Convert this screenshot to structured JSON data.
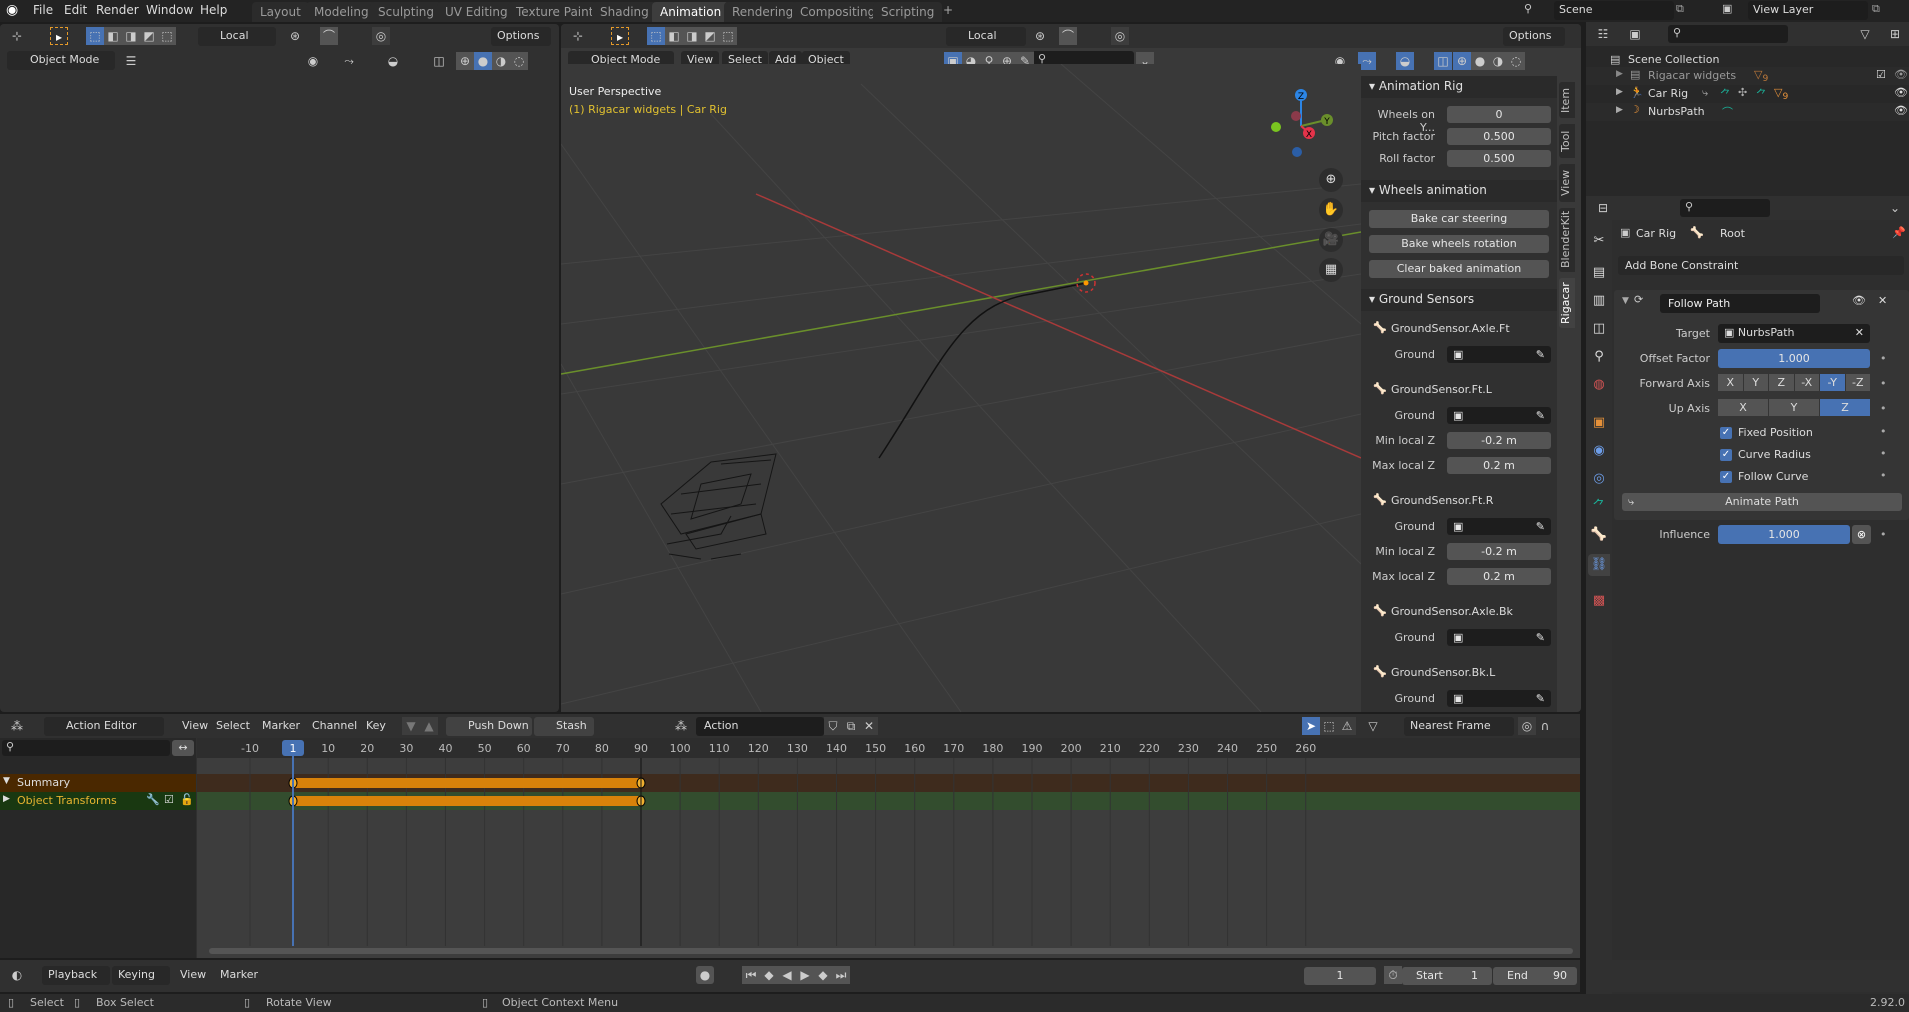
{
  "topbar": {
    "menus": [
      "File",
      "Edit",
      "Render",
      "Window",
      "Help"
    ],
    "workspaces": [
      "Layout",
      "Modeling",
      "Sculpting",
      "UV Editing",
      "Texture Paint",
      "Shading",
      "Animation",
      "Rendering",
      "Compositing",
      "Scripting"
    ],
    "active_workspace": "Animation",
    "add_workspace": "+",
    "scene": "Scene",
    "view_layer": "View Layer"
  },
  "left_view": {
    "transform_orientation": "Local",
    "options": "Options",
    "mode": "Object Mode"
  },
  "viewport": {
    "transform_orientation": "Local",
    "options": "Options",
    "mode": "Object Mode",
    "menus": [
      "View",
      "Select",
      "Add",
      "Object"
    ],
    "perspective": "User Perspective",
    "active_info": "(1) Rigacar widgets | Car Rig",
    "gizmo": {
      "x": "X",
      "y": "Y",
      "z": "Z"
    }
  },
  "npanel": {
    "tabs": [
      "Item",
      "Tool",
      "View",
      "BlenderKit",
      "Rigacar"
    ],
    "active_tab": "Rigacar",
    "animation_rig": {
      "title": "Animation Rig",
      "fields": [
        {
          "label": "Wheels on Y...",
          "value": "0"
        },
        {
          "label": "Pitch factor",
          "value": "0.500"
        },
        {
          "label": "Roll factor",
          "value": "0.500"
        }
      ]
    },
    "wheels_animation": {
      "title": "Wheels animation",
      "buttons": [
        "Bake car steering",
        "Bake wheels rotation",
        "Clear baked animation"
      ]
    },
    "ground_sensors": {
      "title": "Ground Sensors",
      "ground_label": "Ground",
      "min_label": "Min local Z",
      "max_label": "Max local Z",
      "sensors": [
        {
          "name": "GroundSensor.Axle.Ft"
        },
        {
          "name": "GroundSensor.Ft.L",
          "min": "-0.2 m",
          "max": "0.2 m"
        },
        {
          "name": "GroundSensor.Ft.R",
          "min": "-0.2 m",
          "max": "0.2 m"
        },
        {
          "name": "GroundSensor.Axle.Bk"
        },
        {
          "name": "GroundSensor.Bk.L"
        }
      ]
    }
  },
  "outliner": {
    "root": "Scene Collection",
    "items": [
      {
        "name": "Rigacar widgets",
        "badge": "9"
      },
      {
        "name": "Car Rig",
        "badge": "9"
      },
      {
        "name": "NurbsPath"
      }
    ]
  },
  "properties": {
    "breadcrumb_object": "Car Rig",
    "breadcrumb_bone": "Root",
    "add_constraint": "Add Bone Constraint",
    "constraint": {
      "name": "Follow Path",
      "target_label": "Target",
      "target": "NurbsPath",
      "offset_label": "Offset Factor",
      "offset": "1.000",
      "forward_label": "Forward Axis",
      "forward_options": [
        "X",
        "Y",
        "Z",
        "-X",
        "-Y",
        "-Z"
      ],
      "forward_selected": "-Y",
      "up_label": "Up Axis",
      "up_options": [
        "X",
        "Y",
        "Z"
      ],
      "up_selected": "Z",
      "checkboxes": [
        {
          "label": "Fixed Position",
          "checked": true
        },
        {
          "label": "Curve Radius",
          "checked": true
        },
        {
          "label": "Follow Curve",
          "checked": true
        }
      ],
      "animate_path": "Animate Path",
      "influence_label": "Influence",
      "influence": "1.000"
    }
  },
  "dopesheet": {
    "mode": "Action Editor",
    "menus": [
      "View",
      "Select",
      "Marker",
      "Channel",
      "Key"
    ],
    "push_down": "Push Down",
    "stash": "Stash",
    "action": "Action",
    "snap": "Nearest Frame",
    "current_frame": "1",
    "ticks": [
      "-10",
      "10",
      "20",
      "30",
      "40",
      "50",
      "60",
      "70",
      "80",
      "90",
      "100",
      "110",
      "120",
      "130",
      "140",
      "150",
      "160",
      "170",
      "180",
      "190",
      "200",
      "210",
      "220",
      "230",
      "240",
      "250",
      "260"
    ],
    "channels": [
      {
        "name": "Summary"
      },
      {
        "name": "Object Transforms"
      }
    ],
    "keyframes": [
      1,
      90
    ]
  },
  "timeline": {
    "menus": [
      "Playback",
      "Keying",
      "View",
      "Marker"
    ],
    "current_frame": "1",
    "start_label": "Start",
    "start": "1",
    "end_label": "End",
    "end": "90"
  },
  "statusbar": {
    "select": "Select",
    "box_select": "Box Select",
    "rotate": "Rotate View",
    "context": "Object Context Menu",
    "version": "2.92.0"
  }
}
